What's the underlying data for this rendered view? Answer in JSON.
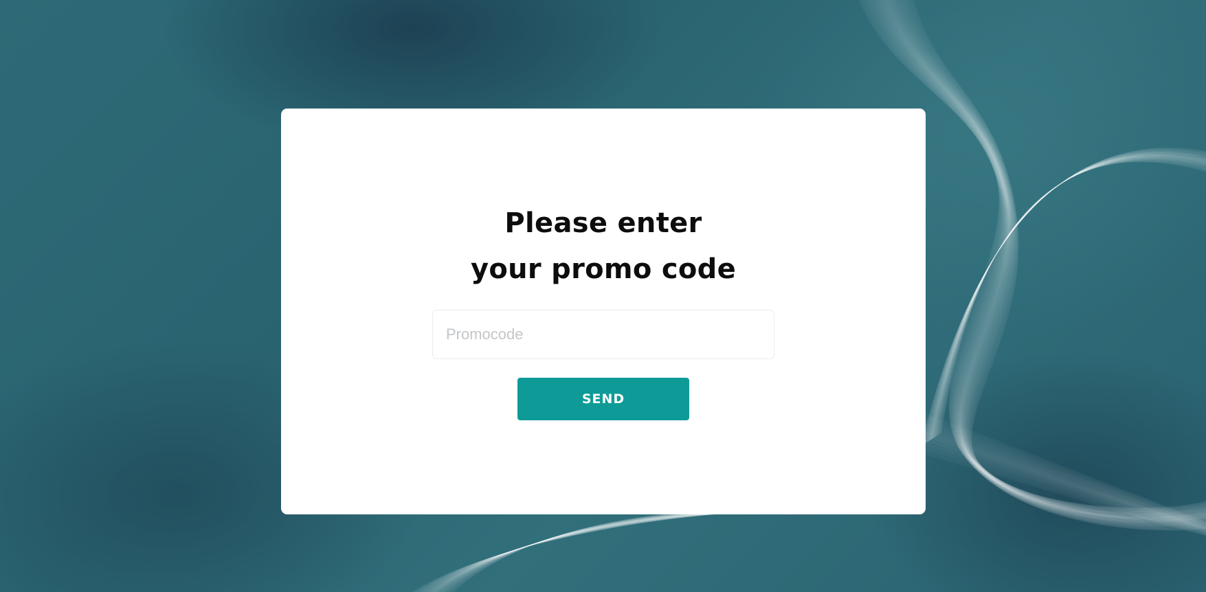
{
  "theme": {
    "accent_color": "#0e9b97",
    "card_background": "#ffffff",
    "background_color": "#2d6a77"
  },
  "promo_form": {
    "title_line_1": "Please enter",
    "title_line_2": "your promo code",
    "input_placeholder": "Promocode",
    "input_value": "",
    "send_label": "SEND"
  }
}
